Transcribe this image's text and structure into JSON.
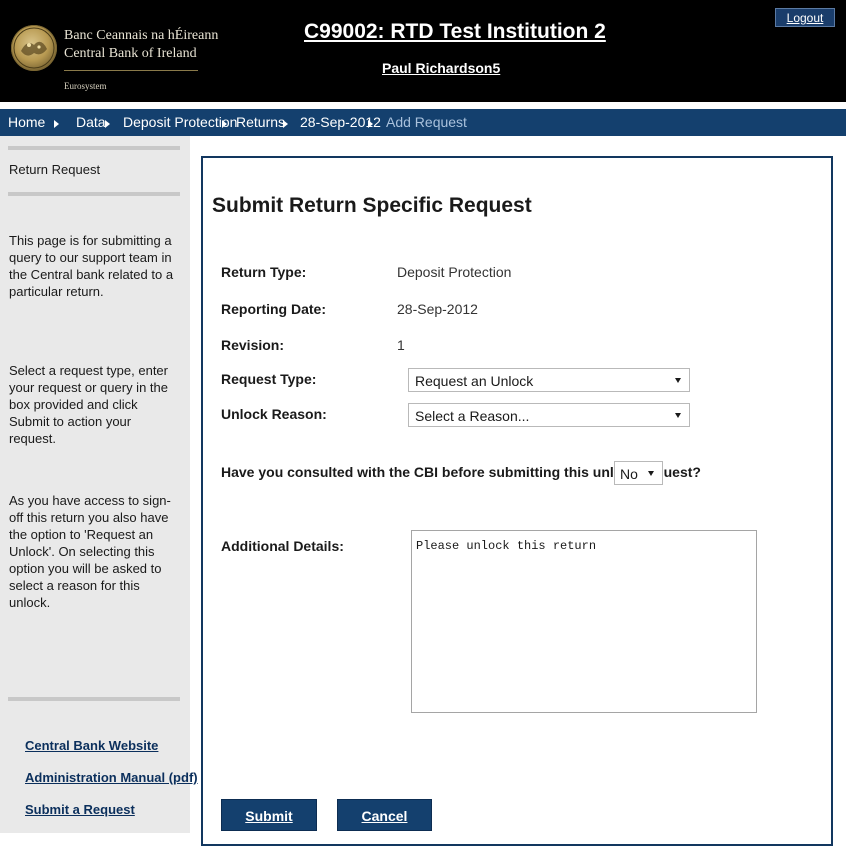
{
  "header": {
    "bank_name_irish": "Banc Ceannais na hÉireann",
    "bank_name_english": "Central Bank of Ireland",
    "eurosystem": "Eurosystem",
    "institution_title": "C99002: RTD Test Institution 2",
    "user_name": "Paul Richardson5",
    "logout_label": "Logout",
    "logo_icon": "central-bank-seal-icon"
  },
  "breadcrumb": {
    "items": [
      "Home",
      "Data",
      "Deposit Protection",
      "Returns",
      "28-Sep-2012"
    ],
    "current": "Add Request"
  },
  "sidebar": {
    "title": "Return Request",
    "paragraphs": [
      "This page is for submitting a query to our support team in the Central bank related to a particular return.",
      "Select a request type, enter your request or query in the box provided and click Submit to action your request.",
      "As you have access to sign-off this return you also have the option to 'Request an Unlock'. On selecting this option you will be asked to select a reason for this unlock."
    ],
    "links": [
      "Central Bank Website",
      "Administration Manual (pdf)",
      "Submit a Request"
    ]
  },
  "form": {
    "title": "Submit Return Specific Request",
    "return_type_label": "Return Type:",
    "return_type_value": "Deposit Protection",
    "reporting_date_label": "Reporting Date:",
    "reporting_date_value": "28-Sep-2012",
    "revision_label": "Revision:",
    "revision_value": "1",
    "request_type_label": "Request Type:",
    "request_type_value": "Request an Unlock",
    "unlock_reason_label": "Unlock Reason:",
    "unlock_reason_value": "Select a Reason...",
    "consulted_question": "Have you consulted with the CBI before submitting this unlock request?",
    "consulted_value": "No",
    "additional_details_label": "Additional Details:",
    "additional_details_value": "Please unlock this return",
    "submit_label": "Submit",
    "cancel_label": "Cancel"
  },
  "colors": {
    "header_bg": "#000000",
    "nav_bg": "#14406e",
    "panel_border": "#12375f",
    "sidebar_bg": "#e9e9e9",
    "link": "#0b2f5c"
  }
}
